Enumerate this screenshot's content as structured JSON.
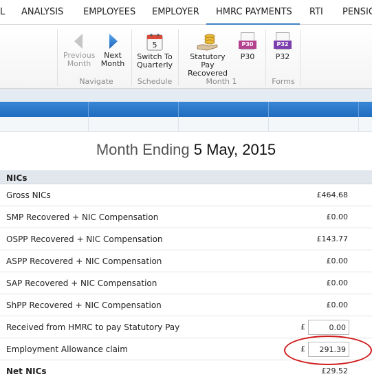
{
  "menu": {
    "tabs": [
      {
        "label": "L"
      },
      {
        "label": "ANALYSIS"
      },
      {
        "label": "EMPLOYEES"
      },
      {
        "label": "EMPLOYER"
      },
      {
        "label": "HMRC PAYMENTS"
      },
      {
        "label": "RTI"
      },
      {
        "label": "PENSIC"
      }
    ],
    "active_tab": "HMRC PAYMENTS",
    "accent_color": "#3e7fc4"
  },
  "ribbon": {
    "navigate": {
      "previous_line1": "Previous",
      "previous_line2": "Month",
      "next_line1": "Next",
      "next_line2": "Month",
      "group_label": "Navigate"
    },
    "schedule": {
      "switch_line1": "Switch To",
      "switch_line2": "Quarterly",
      "calendar_day": "5",
      "group_label": "Schedule"
    },
    "month": {
      "statutory_line1": "Statutory Pay",
      "statutory_line2": "Recovered",
      "p30_label": "P30",
      "p30_badge": "P30",
      "group_label": "Month 1"
    },
    "forms": {
      "p32_label": "P32",
      "p32_badge": "P32",
      "group_label": "Forms"
    }
  },
  "title": {
    "prefix": "Month Ending",
    "date": "5 May, 2015"
  },
  "nics": {
    "section_title": "NICs",
    "rows": [
      {
        "label": "Gross NICs",
        "value": "£464.68"
      },
      {
        "label": "SMP Recovered + NIC Compensation",
        "value": "£0.00"
      },
      {
        "label": "OSPP Recovered + NIC Compensation",
        "value": "£143.77"
      },
      {
        "label": "ASPP Recovered + NIC Compensation",
        "value": "£0.00"
      },
      {
        "label": "SAP Recovered + NIC Compensation",
        "value": "£0.00"
      },
      {
        "label": "ShPP Recovered + NIC Compensation",
        "value": "£0.00"
      }
    ],
    "received_from_hmrc": {
      "label": "Received from HMRC to pay Statutory Pay",
      "currency": "£",
      "value": "0.00"
    },
    "employment_allowance": {
      "label": "Employment Allowance claim",
      "currency": "£",
      "value": "291.39"
    },
    "net_nics": {
      "label": "Net NICs",
      "value": "£29.52"
    }
  },
  "colors": {
    "header_blue": "#2a78cc",
    "highlight_circle": "#d11a1a",
    "p30_badge": "#b3428f",
    "p32_badge": "#7d3fae"
  }
}
